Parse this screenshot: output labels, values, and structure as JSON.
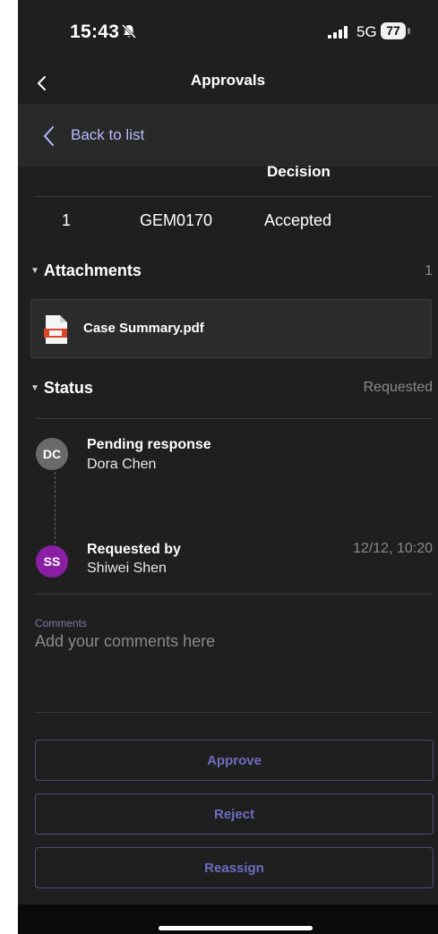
{
  "status_bar": {
    "time": "15:43",
    "network": "5G",
    "battery": "77",
    "icons": [
      "bell-slash-icon",
      "signal-bars-icon",
      "battery-icon"
    ]
  },
  "header": {
    "title": "Approvals",
    "back_icon": "chevron-left-icon"
  },
  "back_to_list": {
    "label": "Back to list",
    "icon": "chevron-left-icon"
  },
  "table": {
    "visible_header": "Decision",
    "rows": [
      {
        "no": "1",
        "id": "GEM0170",
        "decision": "Accepted"
      }
    ]
  },
  "attachments": {
    "title": "Attachments",
    "count": "1",
    "items": [
      {
        "name": "Case Summary.pdf",
        "icon": "pdf-file-icon"
      }
    ]
  },
  "status": {
    "title": "Status",
    "value": "Requested",
    "entries": [
      {
        "initials": "DC",
        "title": "Pending response",
        "name": "Dora Chen",
        "time": ""
      },
      {
        "initials": "SS",
        "title": "Requested by",
        "name": "Shiwei Shen",
        "time": "12/12, 10:20"
      }
    ]
  },
  "comments": {
    "label": "Comments",
    "placeholder": "Add your comments here"
  },
  "actions": {
    "approve": "Approve",
    "reject": "Reject",
    "reassign": "Reassign"
  },
  "colors": {
    "background": "#1f1f1f",
    "accent": "#6d6dc2",
    "link": "#b9b9ff",
    "avatar_ss": "#8b1fa3",
    "avatar_dc": "#6a6a6a"
  }
}
